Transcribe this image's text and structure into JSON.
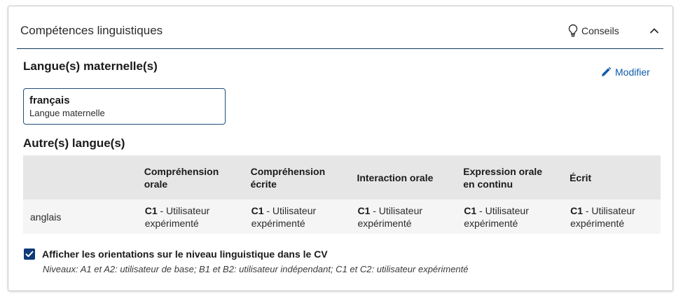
{
  "header": {
    "title": "Compétences linguistiques",
    "tips_label": "Conseils"
  },
  "mother_tongue": {
    "section_title": "Langue(s) maternelle(s)",
    "edit_label": "Modifier",
    "language": "français",
    "caption": "Langue maternelle"
  },
  "other_languages": {
    "section_title": "Autre(s) langue(s)",
    "columns": [
      [
        "Compréhension",
        "orale"
      ],
      [
        "Compréhension",
        "écrite"
      ],
      [
        "Interaction orale"
      ],
      [
        "Expression orale",
        "en continu"
      ],
      [
        "Écrit"
      ]
    ],
    "rows": [
      {
        "language": "anglais",
        "levels": [
          {
            "code": "C1",
            "rest": " - Utilisateur",
            "line2": "expérimenté"
          },
          {
            "code": "C1",
            "rest": " - Utilisateur",
            "line2": "expérimenté"
          },
          {
            "code": "C1",
            "rest": " - Utilisateur",
            "line2": "expérimenté"
          },
          {
            "code": "C1",
            "rest": " - Utilisateur",
            "line2": "expérimenté"
          },
          {
            "code": "C1",
            "rest": " - Utilisateur",
            "line2": "expérimenté"
          }
        ]
      }
    ]
  },
  "guidance": {
    "checkbox_label": "Afficher les orientations sur le niveau linguistique dans le CV",
    "checked": true,
    "note": "Niveaux: A1 et A2: utilisateur de base; B1 et B2: utilisateur indépendant; C1 et C2: utilisateur expérimenté"
  },
  "colors": {
    "accent": "#0e5ca8",
    "rule": "#0e3a5c",
    "checkbox": "#0e3a7a"
  },
  "icons": {
    "tips": "lightbulb-icon",
    "collapse": "chevron-up-icon",
    "edit": "pencil-icon",
    "check": "checkmark-icon"
  }
}
